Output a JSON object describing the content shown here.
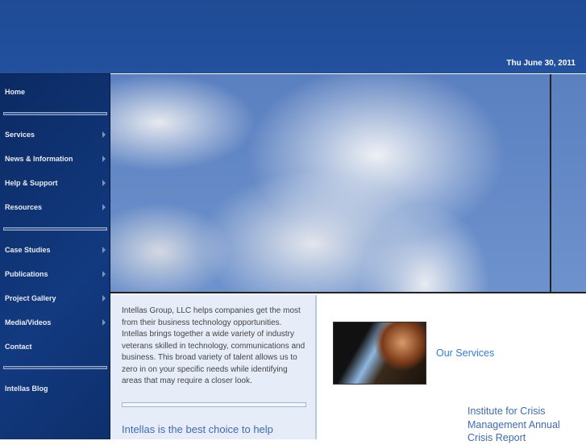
{
  "header": {
    "date": "Thu June 30, 2011"
  },
  "nav": [
    {
      "label": "Home",
      "arrow": false
    },
    {
      "label": "Services",
      "arrow": true
    },
    {
      "label": "News & Information",
      "arrow": true
    },
    {
      "label": "Help & Support",
      "arrow": true
    },
    {
      "label": "Resources",
      "arrow": true
    },
    {
      "label": "Case Studies",
      "arrow": true
    },
    {
      "label": "Publications",
      "arrow": true
    },
    {
      "label": "Project Gallery",
      "arrow": true
    },
    {
      "label": "Media/Videos",
      "arrow": true
    },
    {
      "label": "Contact",
      "arrow": false
    },
    {
      "label": "Intellas Blog",
      "arrow": false
    }
  ],
  "main": {
    "intro": "Intellas Group, LLC helps companies get the most from their business technology opportunities. Intellas brings together a wide variety of industry veterans skilled in technology, communications and business. This broad variety of talent allows us to zero in on your specific needs while identifying areas that may require a closer look.",
    "tagline": "Intellas is the best choice to help",
    "services_link": "Our Services",
    "report_link": "Institute for Crisis Management Annual Crisis Report"
  }
}
